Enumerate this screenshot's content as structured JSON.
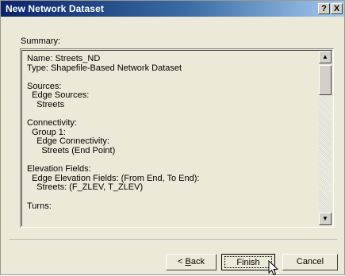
{
  "window": {
    "title": "New Network Dataset",
    "help_label": "?",
    "close_label": "X"
  },
  "summary": {
    "label": "Summary:",
    "lines": [
      "Name: Streets_ND",
      "Type: Shapefile-Based Network Dataset",
      "",
      "Sources:",
      "  Edge Sources:",
      "    Streets",
      "",
      "Connectivity:",
      "  Group 1:",
      "    Edge Connectivity:",
      "      Streets (End Point)",
      "",
      "Elevation Fields:",
      "  Edge Elevation Fields: (From End, To End):",
      "    Streets: (F_ZLEV, T_ZLEV)",
      "",
      "Turns:"
    ]
  },
  "buttons": {
    "back_prefix": "< ",
    "back_accel": "B",
    "back_rest": "ack",
    "finish": "Finish",
    "cancel": "Cancel"
  },
  "icons": {
    "scroll_up": "scroll-up-arrow",
    "scroll_down": "scroll-down-arrow",
    "cursor": "mouse-pointer"
  }
}
